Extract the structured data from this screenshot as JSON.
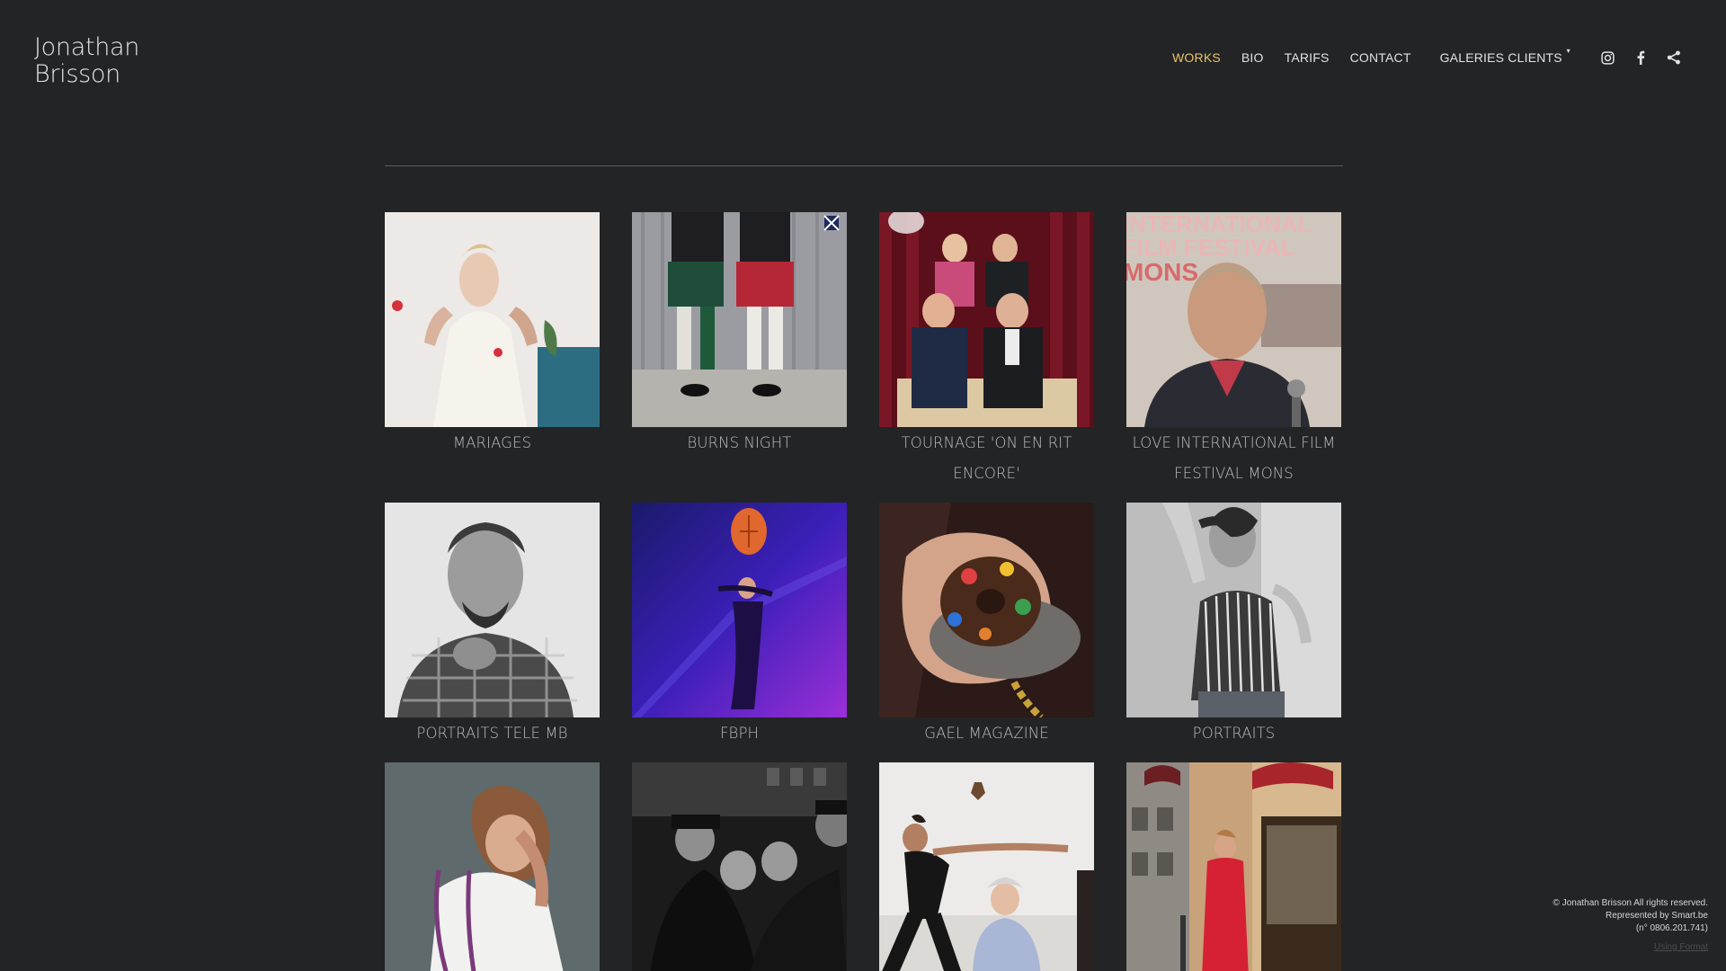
{
  "site": {
    "logo_line1": "Jonathan",
    "logo_line2": "Brisson"
  },
  "nav": {
    "items": [
      {
        "label": "WORKS",
        "active": true
      },
      {
        "label": "BIO"
      },
      {
        "label": "TARIFS"
      },
      {
        "label": "CONTACT"
      }
    ],
    "galleries_label": "GALERIES CLIENTS",
    "caret": "▾",
    "accent_color": "#e8c36a"
  },
  "social": [
    "instagram-icon",
    "facebook-icon",
    "share-icon"
  ],
  "gallery": [
    {
      "title": "MARIAGES"
    },
    {
      "title": "BURNS NIGHT"
    },
    {
      "title": "TOURNAGE 'ON EN RIT ENCORE'"
    },
    {
      "title": "LOVE INTERNATIONAL FILM FESTIVAL MONS"
    },
    {
      "title": "PORTRAITS TELE MB"
    },
    {
      "title": "FBPH"
    },
    {
      "title": "GAEL MAGAZINE"
    },
    {
      "title": "PORTRAITS"
    },
    {
      "title": ""
    },
    {
      "title": ""
    },
    {
      "title": ""
    },
    {
      "title": ""
    }
  ],
  "footer": {
    "line1": "© Jonathan Brisson All rights reserved.",
    "line2": "Represented by Smart.be",
    "line3": "(n° 0806.201.741)",
    "using": "Using Format"
  }
}
